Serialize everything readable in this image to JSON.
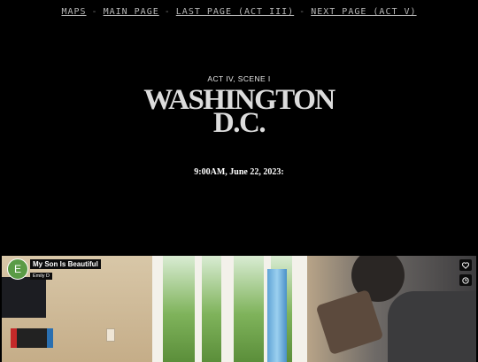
{
  "nav": {
    "maps": "MAPS",
    "main_page": "MAIN PAGE",
    "last_page": "LAST PAGE (ACT III)",
    "next_page": "NEXT PAGE (ACT V)",
    "separator": "-"
  },
  "header": {
    "act_scene": "ACT IV, SCENE I",
    "title_line1": "WASHINGTON",
    "title_line2": "D.C.",
    "timestamp": "9:00AM, June 22, 2023:"
  },
  "video": {
    "channel_initial": "E",
    "title": "My Son Is Beautiful",
    "author": "Emily D",
    "icons": [
      "heart-icon",
      "clock-icon"
    ]
  }
}
